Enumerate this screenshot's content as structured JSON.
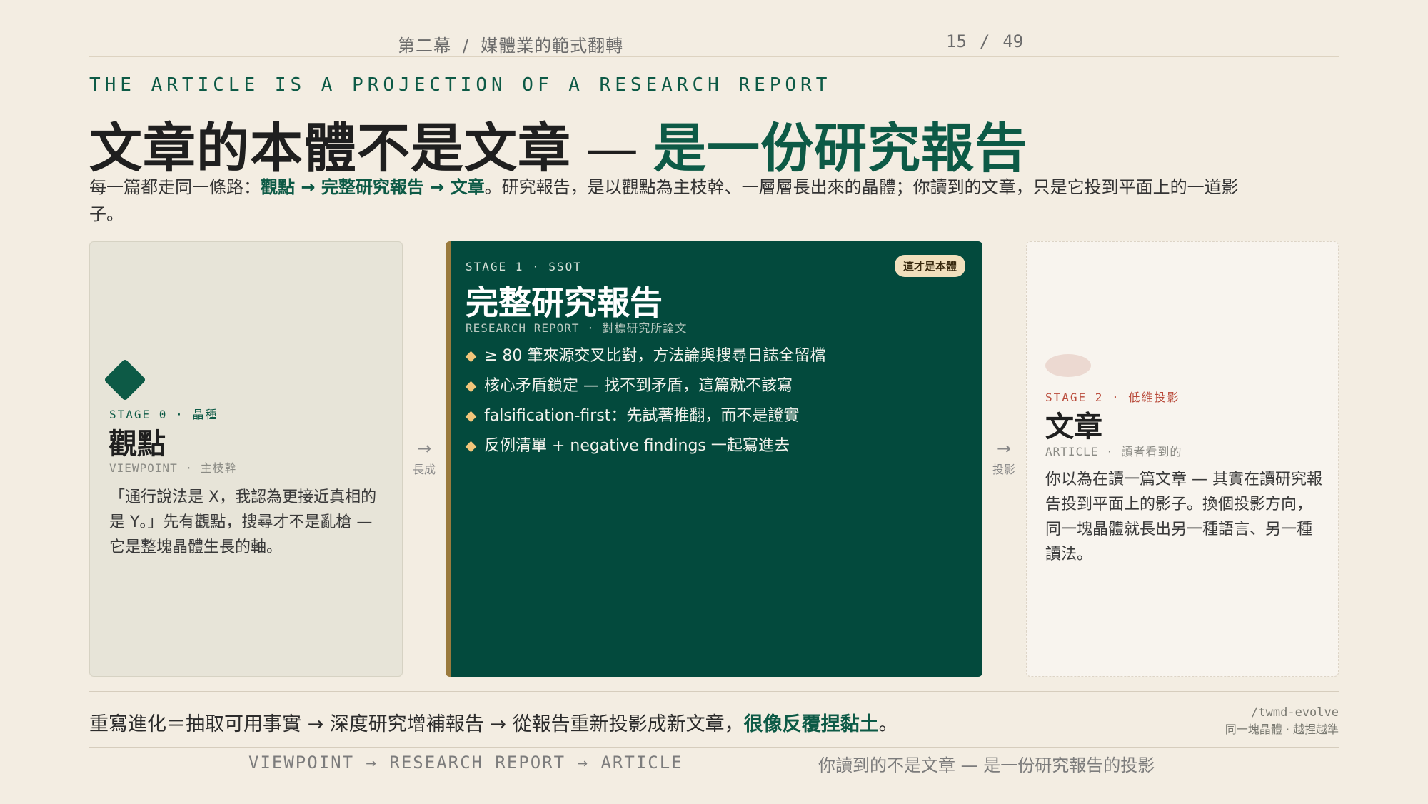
{
  "header": {
    "crumb_part1": "第二幕",
    "crumb_sep": "/",
    "crumb_part2": "媒體業的範式翻轉",
    "page_current": "15",
    "page_sep": "/",
    "page_total": "49"
  },
  "eyebrow": "THE ARTICLE IS A PROJECTION OF A RESEARCH REPORT",
  "title": {
    "main": "文章的本體不是文章",
    "dash": "—",
    "accent": "是一份研究報告"
  },
  "intro": {
    "prefix": "每一篇都走同一條路：",
    "path": "觀點 → 完整研究報告 → 文章",
    "rest": "。研究報告，是以觀點為主枝幹、一層層長出來的晶體；你讀到的文章，只是它投到平面上的一道影子。"
  },
  "cards": {
    "viewpoint": {
      "stage": "STAGE 0 · 晶種",
      "title": "觀點",
      "sub": "VIEWPOINT · 主枝幹",
      "body": "「通行說法是 X，我認為更接近真相的是 Y。」先有觀點，搜尋才不是亂槍 — 它是整塊晶體生長的軸。"
    },
    "report": {
      "stage": "STAGE 1 · SSOT",
      "badge": "這才是本體",
      "title": "完整研究報告",
      "sub": "RESEARCH REPORT · 對標研究所論文",
      "bullets": [
        "≥ 80 筆來源交叉比對，方法論與搜尋日誌全留檔",
        "核心矛盾鎖定 — 找不到矛盾，這篇就不該寫",
        "falsification-first：先試著推翻，而不是證實",
        "反例清單 + negative findings 一起寫進去"
      ]
    },
    "article": {
      "stage": "STAGE 2 · 低維投影",
      "title": "文章",
      "sub": "ARTICLE · 讀者看到的",
      "body": "你以為在讀一篇文章 — 其實在讀研究報告投到平面上的影子。換個投影方向，同一塊晶體就長出另一種語言、另一種讀法。"
    }
  },
  "arrows": {
    "grow_symbol": "→",
    "grow_label": "長成",
    "project_symbol": "→",
    "project_label": "投影"
  },
  "summary": {
    "text": "重寫進化＝抽取可用事實 → 深度研究增補報告 → 從報告重新投影成新文章，",
    "emphasis": "很像反覆捏黏土",
    "end": "。"
  },
  "signature": {
    "command": "/twmd-evolve",
    "tagline": "同一塊晶體 · 越捏越準"
  },
  "footer": {
    "left": "VIEWPOINT → RESEARCH REPORT → ARTICLE",
    "right": "你讀到的不是文章 — 是一份研究報告的投影"
  },
  "colors": {
    "background": "#f3ede2",
    "accent_green": "#0d5a46",
    "card_dark": "#034a3d",
    "badge": "#f1dfbd",
    "stage2_red": "#b94a3a"
  }
}
